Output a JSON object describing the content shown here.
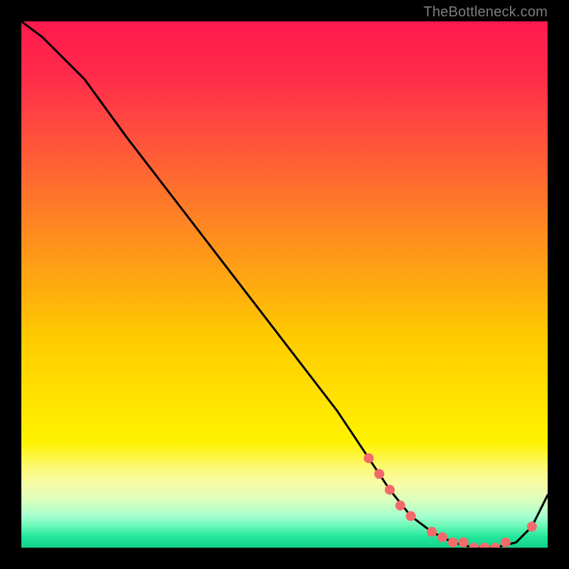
{
  "attribution": "TheBottleneck.com",
  "colors": {
    "curve": "#000000",
    "marker": "#f36a6a",
    "gradient_top": "#ff1a4d",
    "gradient_bottom": "#12d38a"
  },
  "chart_data": {
    "type": "line",
    "title": "",
    "xlabel": "",
    "ylabel": "",
    "xlim": [
      0,
      100
    ],
    "ylim": [
      0,
      100
    ],
    "grid": false,
    "legend": false,
    "series": [
      {
        "name": "curve",
        "x": [
          0,
          4,
          8,
          12,
          20,
          30,
          40,
          50,
          60,
          66,
          70,
          74,
          78,
          82,
          86,
          90,
          94,
          97,
          100
        ],
        "y": [
          100,
          97,
          93,
          89,
          78,
          65,
          52,
          39,
          26,
          17,
          11,
          6,
          3,
          1,
          0,
          0,
          1,
          4,
          10
        ]
      }
    ],
    "markers": [
      {
        "x": 66,
        "y": 17
      },
      {
        "x": 68,
        "y": 14
      },
      {
        "x": 70,
        "y": 11
      },
      {
        "x": 72,
        "y": 8
      },
      {
        "x": 74,
        "y": 6
      },
      {
        "x": 78,
        "y": 3
      },
      {
        "x": 80,
        "y": 2
      },
      {
        "x": 82,
        "y": 1
      },
      {
        "x": 84,
        "y": 1
      },
      {
        "x": 86,
        "y": 0
      },
      {
        "x": 88,
        "y": 0
      },
      {
        "x": 90,
        "y": 0
      },
      {
        "x": 92,
        "y": 1
      },
      {
        "x": 97,
        "y": 4
      }
    ]
  }
}
